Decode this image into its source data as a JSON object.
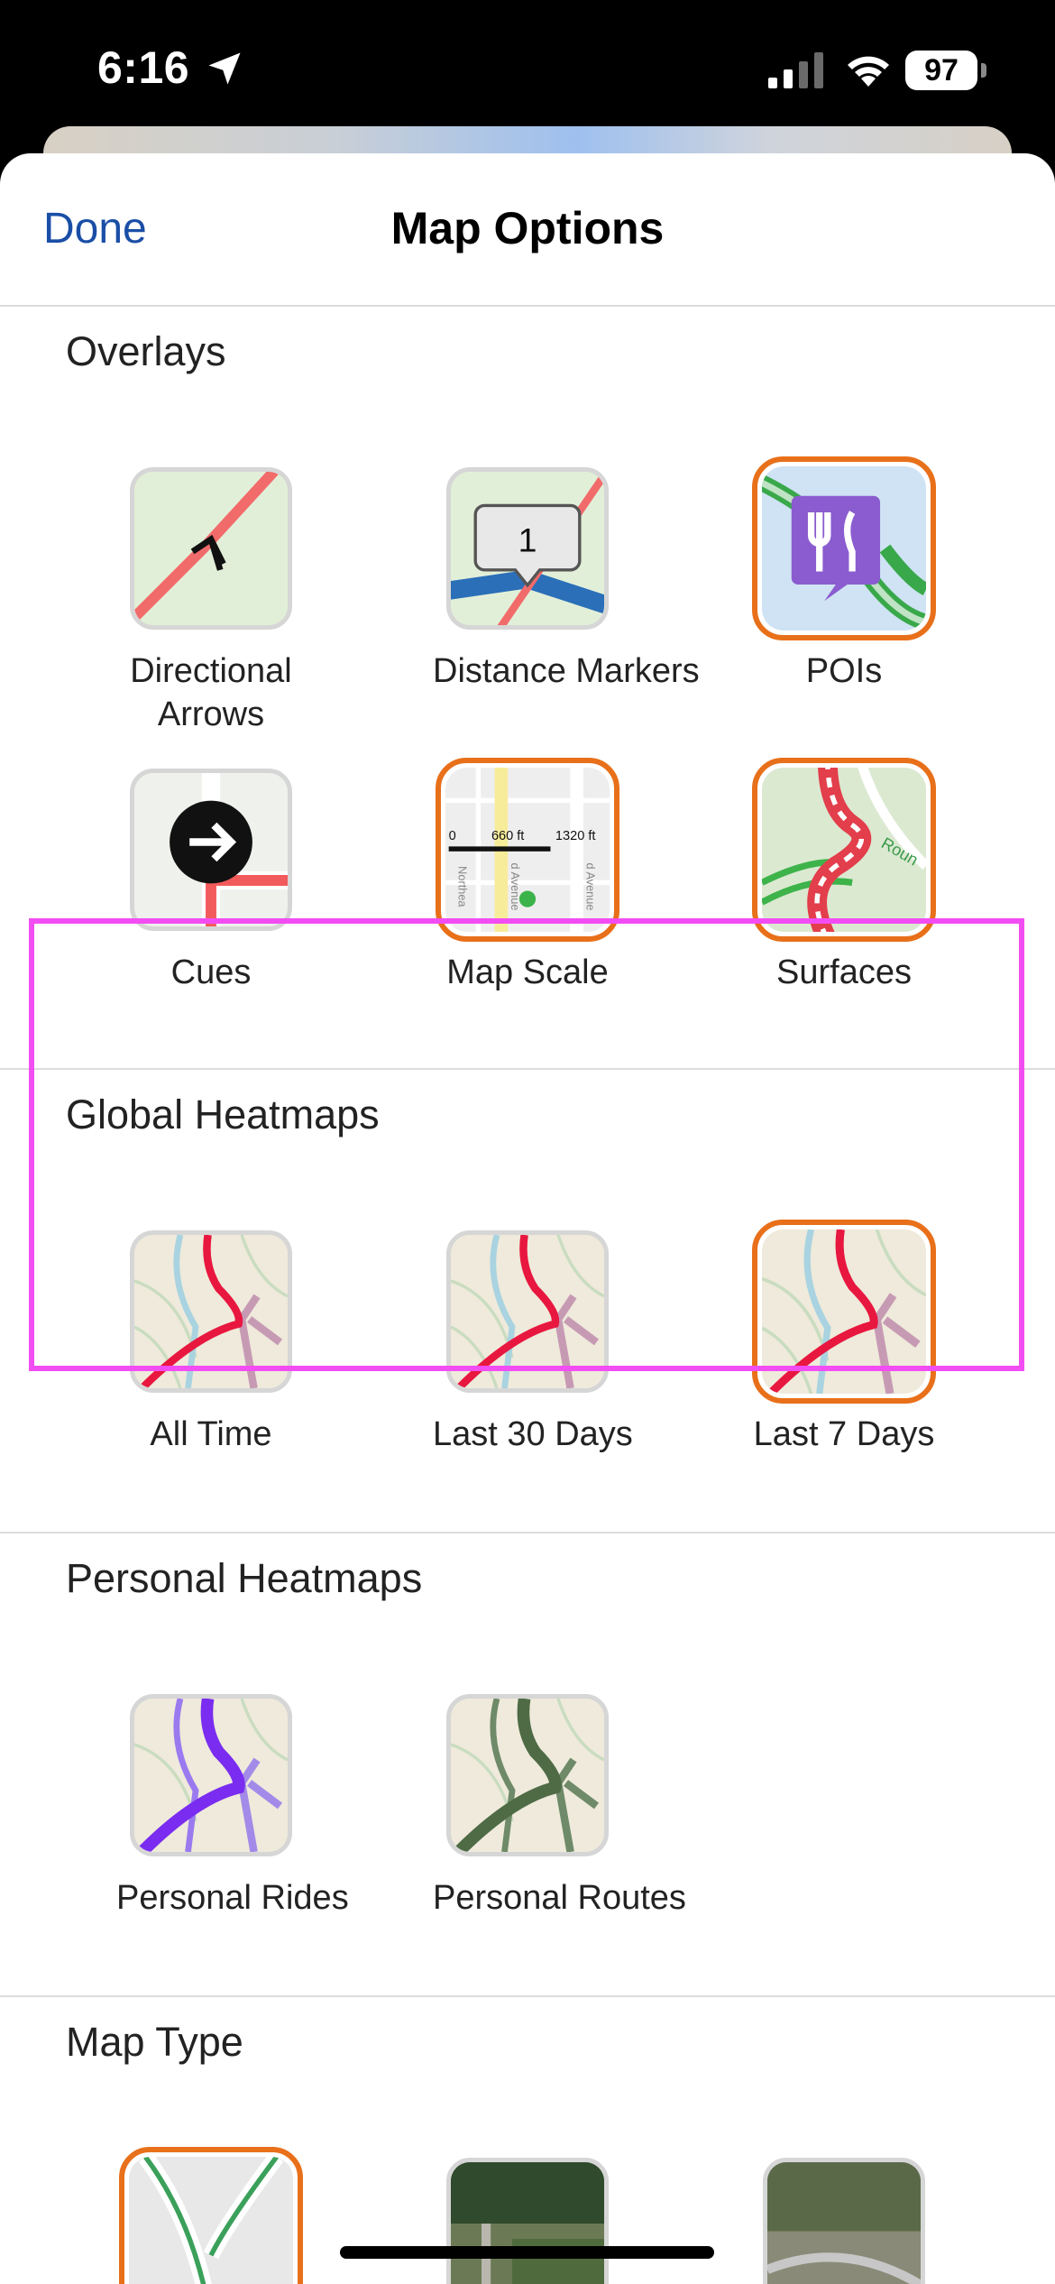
{
  "status_bar": {
    "time": "6:16",
    "battery": "97"
  },
  "nav": {
    "done_label": "Done",
    "title": "Map Options"
  },
  "overlays": {
    "title": "Overlays",
    "items": [
      {
        "label": "Directional\nArrows",
        "selected": false,
        "icon": "directional-arrows"
      },
      {
        "label": "Distance Markers",
        "selected": false,
        "icon": "distance-markers",
        "marker_number": "1"
      },
      {
        "label": "POIs",
        "selected": true,
        "icon": "pois"
      },
      {
        "label": "Cues",
        "selected": false,
        "icon": "cues"
      },
      {
        "label": "Map Scale",
        "selected": true,
        "icon": "map-scale",
        "scale_labels": [
          "0",
          "660 ft",
          "1320 ft"
        ],
        "street_labels": [
          "Northea",
          "d Avenue",
          "d Avenue"
        ]
      },
      {
        "label": "Surfaces",
        "selected": true,
        "icon": "surfaces",
        "road_label": "Roun"
      }
    ]
  },
  "global_heatmaps": {
    "title": "Global Heatmaps",
    "items": [
      {
        "label": "All Time",
        "selected": false
      },
      {
        "label": "Last 30 Days",
        "selected": false
      },
      {
        "label": "Last 7 Days",
        "selected": true
      }
    ]
  },
  "personal_heatmaps": {
    "title": "Personal Heatmaps",
    "items": [
      {
        "label": "Personal Rides",
        "selected": false
      },
      {
        "label": "Personal Routes",
        "selected": false
      }
    ]
  },
  "map_type": {
    "title": "Map Type"
  },
  "colors": {
    "accent_selected": "#e8701a",
    "link": "#1a4ea6",
    "highlight": "#f24df2",
    "heat_red": "#e8173f",
    "personal_purple": "#7a2cf0",
    "personal_green": "#4e6b46"
  }
}
